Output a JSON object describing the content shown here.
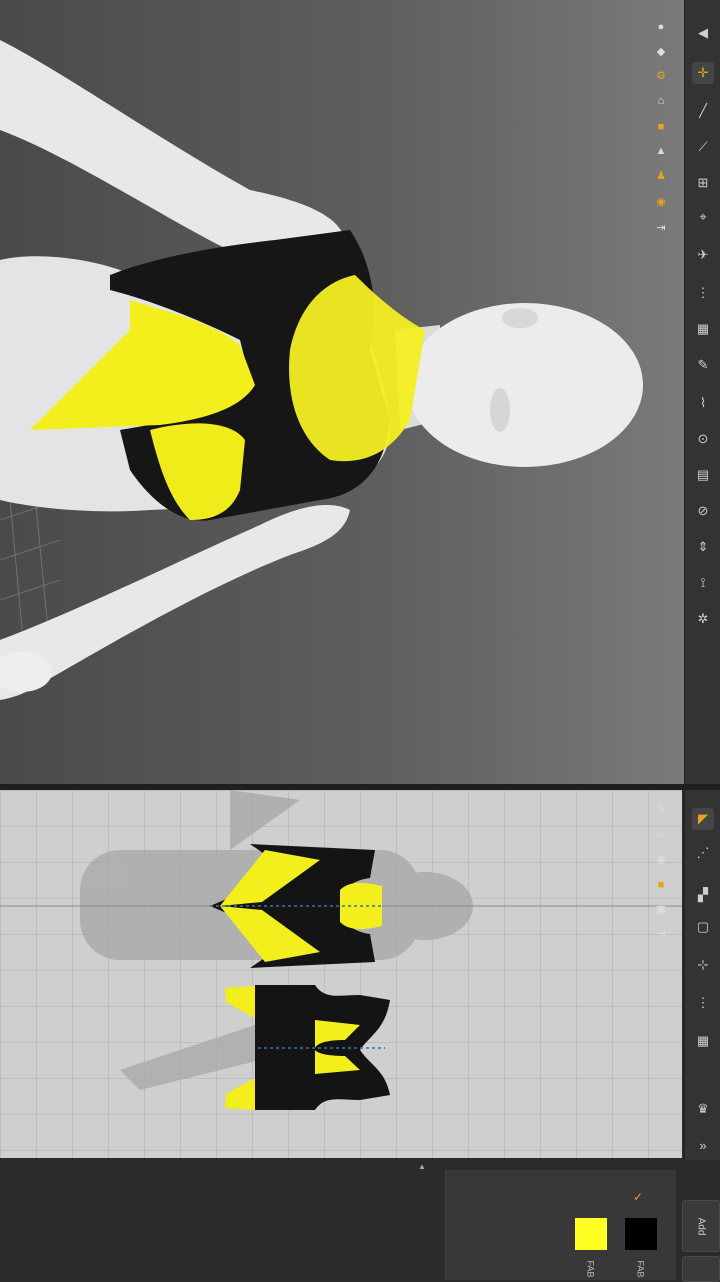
{
  "bottom_panel": {
    "add_label": "Add",
    "fabrics": [
      {
        "label": "FAB",
        "color": "#ffff22"
      },
      {
        "label": "FAB",
        "color": "#000000"
      }
    ]
  },
  "colors": {
    "garment_yellow": "#f2ef1d",
    "garment_black": "#141414",
    "accent_orange": "#e8a21c",
    "avatar": "#e6e6e6"
  },
  "toolbar3d": {
    "icons": [
      "simulate-icon",
      "select-move-icon",
      "edit-pattern-icon",
      "segment-icon",
      "fold-icon",
      "pin-icon",
      "arrangement-icon",
      "tack-icon",
      "texture-icon",
      "brush-icon",
      "measure-icon",
      "puckering-icon",
      "zipper-icon",
      "button-icon",
      "line-icon",
      "topstitch-icon"
    ]
  },
  "toolbar2d": {
    "icons": [
      "transform-pattern-icon",
      "edit-point-icon",
      "polygon-icon",
      "rectangle-icon",
      "internal-line-icon",
      "segment-sewing-icon",
      "free-sewing-icon",
      "fold-arrangement-icon",
      "collapse-icon"
    ]
  },
  "side_icons_3d": [
    "display-avatar-icon",
    "display-garment-icon",
    "gear-icon",
    "hanger-icon",
    "fabric-icon",
    "pin-view-icon",
    "avatar-icon",
    "texture-ball-icon",
    "export-icon"
  ],
  "side_icons_2d": [
    "edit-icon",
    "sewing-icon",
    "pattern-color-icon",
    "fabric-color-icon",
    "layer-icon",
    "export-2d-icon"
  ]
}
